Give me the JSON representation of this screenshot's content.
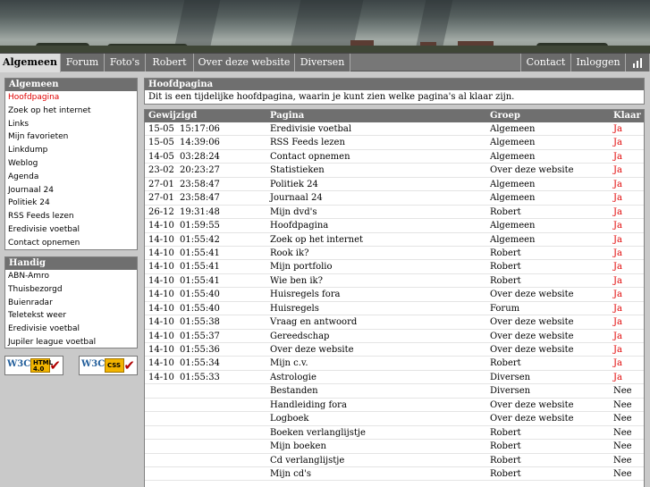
{
  "nav": {
    "left_tabs": [
      "Algemeen",
      "Forum",
      "Foto's",
      "Robert",
      "Over deze website",
      "Diversen"
    ],
    "right_tabs": [
      "Contact",
      "Inloggen"
    ],
    "active_tab": "Algemeen",
    "stats_icon": "bar-chart-icon"
  },
  "sidebar": {
    "algemeen": {
      "title": "Algemeen",
      "items": [
        "Hoofdpagina",
        "Zoek op het internet",
        "Links",
        "Mijn favorieten",
        "Linkdump",
        "Weblog",
        "Agenda",
        "Journaal 24",
        "Politiek 24",
        "RSS Feeds lezen",
        "Eredivisie voetbal",
        "Contact opnemen"
      ],
      "active_item": "Hoofdpagina"
    },
    "handig": {
      "title": "Handig",
      "items": [
        "ABN-Amro",
        "Thuisbezorgd",
        "Buienradar",
        "Teletekst weer",
        "Eredivisie voetbal",
        "Jupiler league voetbal"
      ]
    },
    "badges": [
      {
        "logo": "W3C",
        "label_top": "HTML",
        "label_bottom": "4.0"
      },
      {
        "logo": "W3C",
        "label_top": "CSS",
        "label_bottom": ""
      }
    ]
  },
  "main": {
    "intro_title": "Hoofdpagina",
    "intro_text": "Dit is een tijdelijke hoofdpagina, waarin je kunt zien welke pagina's al klaar zijn.",
    "table": {
      "headers": {
        "changed": "Gewijzigd",
        "page": "Pagina",
        "group": "Groep",
        "ready": "Klaar"
      },
      "rows": [
        {
          "date": "15-05",
          "time": "15:17:06",
          "page": "Eredivisie voetbal",
          "group": "Algemeen",
          "ready": "Ja"
        },
        {
          "date": "15-05",
          "time": "14:39:06",
          "page": "RSS Feeds lezen",
          "group": "Algemeen",
          "ready": "Ja"
        },
        {
          "date": "14-05",
          "time": "03:28:24",
          "page": "Contact opnemen",
          "group": "Algemeen",
          "ready": "Ja"
        },
        {
          "date": "23-02",
          "time": "20:23:27",
          "page": "Statistieken",
          "group": "Over deze website",
          "ready": "Ja"
        },
        {
          "date": "27-01",
          "time": "23:58:47",
          "page": "Politiek 24",
          "group": "Algemeen",
          "ready": "Ja"
        },
        {
          "date": "27-01",
          "time": "23:58:47",
          "page": "Journaal 24",
          "group": "Algemeen",
          "ready": "Ja"
        },
        {
          "date": "26-12",
          "time": "19:31:48",
          "page": "Mijn dvd's",
          "group": "Robert",
          "ready": "Ja"
        },
        {
          "date": "14-10",
          "time": "01:59:55",
          "page": "Hoofdpagina",
          "group": "Algemeen",
          "ready": "Ja"
        },
        {
          "date": "14-10",
          "time": "01:55:42",
          "page": "Zoek op het internet",
          "group": "Algemeen",
          "ready": "Ja"
        },
        {
          "date": "14-10",
          "time": "01:55:41",
          "page": "Rook ik?",
          "group": "Robert",
          "ready": "Ja"
        },
        {
          "date": "14-10",
          "time": "01:55:41",
          "page": "Mijn portfolio",
          "group": "Robert",
          "ready": "Ja"
        },
        {
          "date": "14-10",
          "time": "01:55:41",
          "page": "Wie ben ik?",
          "group": "Robert",
          "ready": "Ja"
        },
        {
          "date": "14-10",
          "time": "01:55:40",
          "page": "Huisregels fora",
          "group": "Over deze website",
          "ready": "Ja"
        },
        {
          "date": "14-10",
          "time": "01:55:40",
          "page": "Huisregels",
          "group": "Forum",
          "ready": "Ja"
        },
        {
          "date": "14-10",
          "time": "01:55:38",
          "page": "Vraag en antwoord",
          "group": "Over deze website",
          "ready": "Ja"
        },
        {
          "date": "14-10",
          "time": "01:55:37",
          "page": "Gereedschap",
          "group": "Over deze website",
          "ready": "Ja"
        },
        {
          "date": "14-10",
          "time": "01:55:36",
          "page": "Over deze website",
          "group": "Over deze website",
          "ready": "Ja"
        },
        {
          "date": "14-10",
          "time": "01:55:34",
          "page": "Mijn c.v.",
          "group": "Robert",
          "ready": "Ja"
        },
        {
          "date": "14-10",
          "time": "01:55:33",
          "page": "Astrologie",
          "group": "Diversen",
          "ready": "Ja"
        },
        {
          "date": "",
          "time": "",
          "page": "Bestanden",
          "group": "Diversen",
          "ready": "Nee"
        },
        {
          "date": "",
          "time": "",
          "page": "Handleiding fora",
          "group": "Over deze website",
          "ready": "Nee"
        },
        {
          "date": "",
          "time": "",
          "page": "Logboek",
          "group": "Over deze website",
          "ready": "Nee"
        },
        {
          "date": "",
          "time": "",
          "page": "Boeken verlanglijstje",
          "group": "Robert",
          "ready": "Nee"
        },
        {
          "date": "",
          "time": "",
          "page": "Mijn boeken",
          "group": "Robert",
          "ready": "Nee"
        },
        {
          "date": "",
          "time": "",
          "page": "Cd verlanglijstje",
          "group": "Robert",
          "ready": "Nee"
        },
        {
          "date": "",
          "time": "",
          "page": "Mijn cd's",
          "group": "Robert",
          "ready": "Nee"
        }
      ]
    }
  },
  "colors": {
    "header_bg": "#6f6f6f",
    "ready_yes": "#e00000",
    "active_link": "#e00000",
    "page_bg": "#c9c9c9"
  }
}
